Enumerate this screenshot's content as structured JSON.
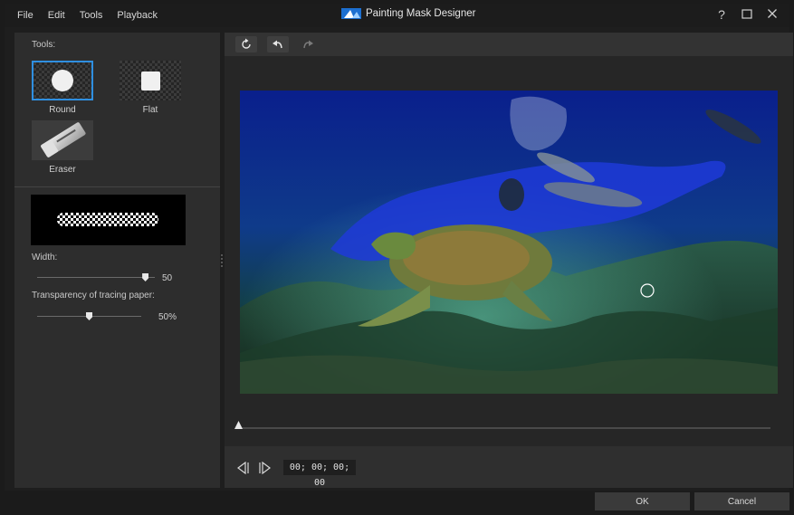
{
  "window": {
    "title": "Painting Mask Designer",
    "help": "?",
    "menu": [
      "File",
      "Edit",
      "Tools",
      "Playback"
    ]
  },
  "tools_panel": {
    "heading": "Tools:",
    "tools": [
      {
        "label": "Round",
        "icon": "round-brush-icon",
        "selected": true
      },
      {
        "label": "Flat",
        "icon": "flat-brush-icon",
        "selected": false
      },
      {
        "label": "Eraser",
        "icon": "eraser-icon",
        "selected": false
      }
    ],
    "width_label": "Width:",
    "width_value": "50",
    "width_level": 0.92,
    "transparency_label": "Transparency of tracing paper:",
    "transparency_value": "50%",
    "transparency_level": 0.5
  },
  "toolbar": {
    "buttons": [
      "reset-icon",
      "undo-icon",
      "redo-icon"
    ]
  },
  "player": {
    "timecode": "00; 00; 00; 00",
    "position": 0
  },
  "footer": {
    "ok": "OK",
    "cancel": "Cancel"
  },
  "colors": {
    "accent": "#2f8fe0",
    "mask": "#1f3ad8"
  }
}
